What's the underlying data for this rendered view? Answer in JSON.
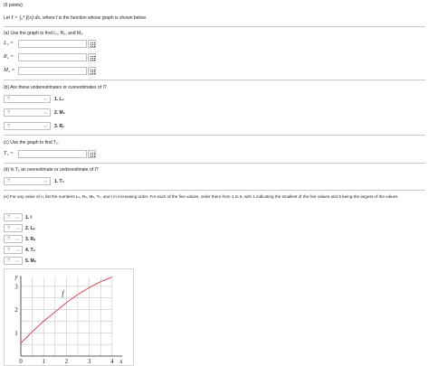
{
  "points": "(6 points)",
  "intro": {
    "prefix": "Let",
    "integral": "I = ∫₀⁴ f(x) dx",
    "suffix": ", where f is the function whose graph is shown below."
  },
  "part_a": {
    "prompt": "(a) Use the graph to find L₂, R₂, and M₂.",
    "fields": [
      {
        "label": "L₂ =",
        "value": ""
      },
      {
        "label": "R₂ =",
        "value": ""
      },
      {
        "label": "M₂ =",
        "value": ""
      }
    ]
  },
  "part_b": {
    "prompt": "(b) Are these underestimates or overestimates of I?",
    "rows": [
      {
        "selected": "?",
        "label": "1. L₂"
      },
      {
        "selected": "?",
        "label": "2. M₂"
      },
      {
        "selected": "?",
        "label": "3. R₂"
      }
    ]
  },
  "part_c": {
    "prompt": "(c) Use the graph to find T₂.",
    "field": {
      "label": "T₂ =",
      "value": ""
    }
  },
  "part_d": {
    "prompt": "(d) Is T₂ an overestimate or underestimate of I?",
    "row": {
      "selected": "?",
      "label": "1. T₂"
    }
  },
  "part_e": {
    "prompt": "(e) For any value of n, list the numbers Lₙ, Rₙ, Mₙ, Tₙ, and I in increasing order. For each of the five values, order them from 1 to 5, with 1 indicating the smallest of the five values and 5 being the largest of the values.",
    "rows": [
      {
        "selected": "?",
        "label": "1. I"
      },
      {
        "selected": "?",
        "label": "2. Lₙ"
      },
      {
        "selected": "?",
        "label": "3. Rₙ"
      },
      {
        "selected": "?",
        "label": "4. Tₙ"
      },
      {
        "selected": "?",
        "label": "5. Mₙ"
      }
    ]
  },
  "chart_data": {
    "type": "line",
    "title": "",
    "xlabel": "x",
    "ylabel": "y",
    "x_ticks": [
      "0",
      "1",
      "2",
      "3",
      "4"
    ],
    "y_ticks": [
      "1",
      "2",
      "3"
    ],
    "xlim": [
      0,
      4.6
    ],
    "ylim": [
      0,
      3.5
    ],
    "grid": true,
    "series": [
      {
        "name": "f",
        "color": "#e0455a",
        "x": [
          0,
          0.5,
          1,
          1.5,
          2,
          2.5,
          3,
          3.5,
          4
        ],
        "y": [
          0.55,
          1.05,
          1.5,
          1.9,
          2.3,
          2.65,
          2.95,
          3.2,
          3.4
        ]
      }
    ]
  }
}
